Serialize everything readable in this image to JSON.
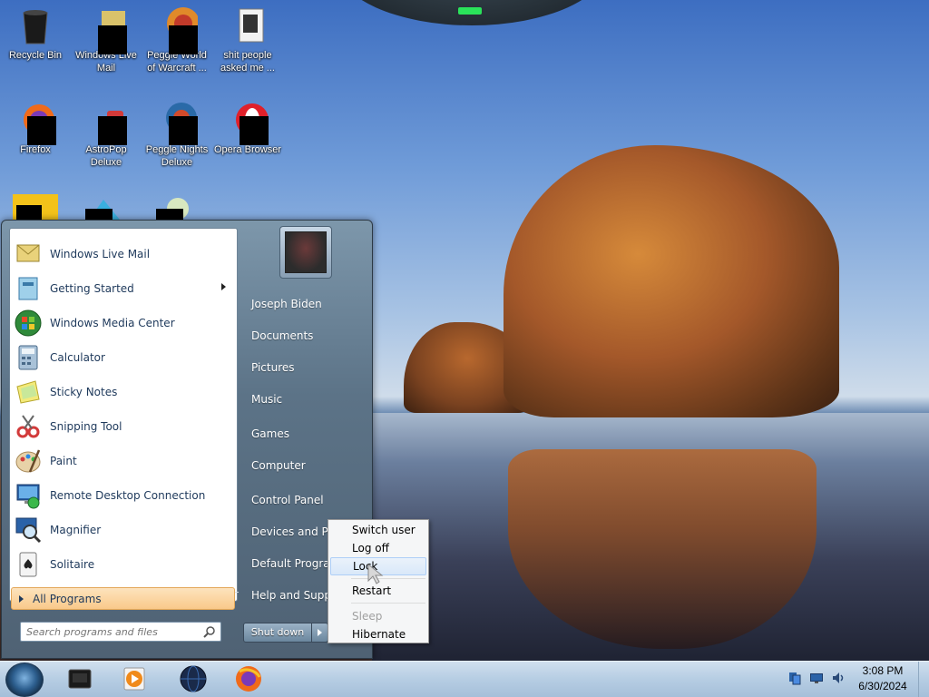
{
  "desktop": {
    "icons": [
      {
        "label": "Recycle Bin",
        "icon": "recycle-bin-icon"
      },
      {
        "label": "Windows Live Mail",
        "icon": "windows-live-mail-icon"
      },
      {
        "label": "Peggle World of Warcraft ...",
        "icon": "peggle-wow-icon"
      },
      {
        "label": "shit people asked me ...",
        "icon": "text-file-icon"
      },
      {
        "label": "Firefox",
        "icon": "firefox-icon"
      },
      {
        "label": "AstroPop Deluxe",
        "icon": "astropop-icon"
      },
      {
        "label": "Peggle Nights Deluxe",
        "icon": "peggle-nights-icon"
      },
      {
        "label": "Opera Browser",
        "icon": "opera-icon"
      }
    ]
  },
  "start_menu": {
    "programs": [
      {
        "label": "Windows Live Mail",
        "icon": "windows-live-mail-icon",
        "color": "#d9b94a"
      },
      {
        "label": "Getting Started",
        "icon": "getting-started-icon",
        "color": "#6fb1d8",
        "submenu": true
      },
      {
        "label": "Windows Media Center",
        "icon": "media-center-icon",
        "color": "#3a9a3a"
      },
      {
        "label": "Calculator",
        "icon": "calculator-icon",
        "color": "#7a9bb8"
      },
      {
        "label": "Sticky Notes",
        "icon": "sticky-notes-icon",
        "color": "#e8df6a"
      },
      {
        "label": "Snipping Tool",
        "icon": "snipping-tool-icon",
        "color": "#d23a3a"
      },
      {
        "label": "Paint",
        "icon": "paint-icon",
        "color": "#c8a26a"
      },
      {
        "label": "Remote Desktop Connection",
        "icon": "remote-desktop-icon",
        "color": "#3a70b0"
      },
      {
        "label": "Magnifier",
        "icon": "magnifier-icon",
        "color": "#5a7ea8"
      },
      {
        "label": "Solitaire",
        "icon": "solitaire-icon",
        "color": "#b0b0b0"
      }
    ],
    "all_programs": "All Programs",
    "search_placeholder": "Search programs and files",
    "right_items": [
      "Joseph Biden",
      "Documents",
      "Pictures",
      "Music",
      "Games",
      "Computer",
      "Control Panel",
      "Devices and Printers",
      "Default Programs",
      "Help and Support"
    ],
    "shutdown_label": "Shut down"
  },
  "shutdown_menu": {
    "items": [
      {
        "label": "Switch user",
        "state": "normal"
      },
      {
        "label": "Log off",
        "state": "normal"
      },
      {
        "label": "Lock",
        "state": "hover"
      },
      {
        "label": "Restart",
        "state": "normal"
      },
      {
        "label": "Sleep",
        "state": "disabled"
      },
      {
        "label": "Hibernate",
        "state": "normal"
      }
    ]
  },
  "taskbar": {
    "pinned": [
      {
        "icon": "desktop-app-icon"
      },
      {
        "icon": "media-player-icon"
      },
      {
        "icon": "globe-icon"
      },
      {
        "icon": "firefox-icon"
      }
    ],
    "tray": [
      "network-icon",
      "monitor-icon",
      "volume-icon"
    ],
    "clock_time": "3:08 PM",
    "clock_date": "6/30/2024"
  }
}
